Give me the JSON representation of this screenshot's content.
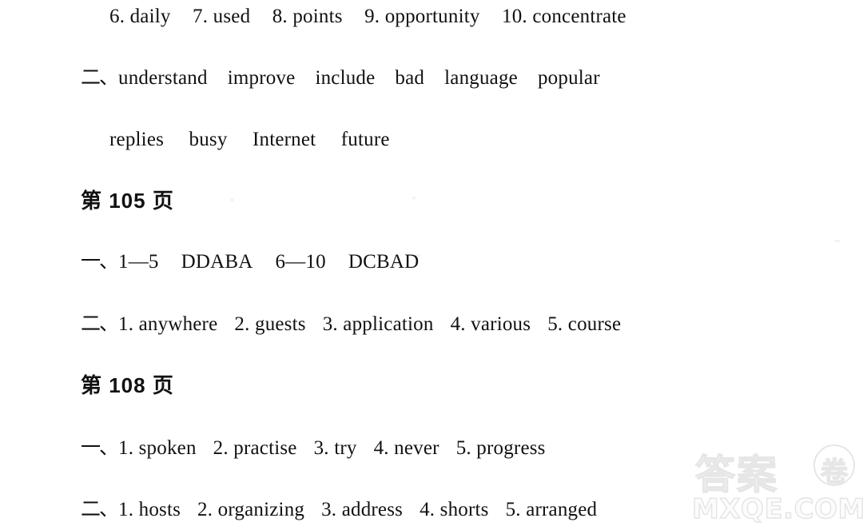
{
  "document": {
    "type": "answer-key-scan",
    "language": "zh-CN",
    "background_color": "#ffffff",
    "text_color": "#111111"
  },
  "lines": [
    {
      "id": "line_vocab_6_10",
      "kind": "answer-items",
      "marker": "",
      "items": [
        "6. daily",
        "7. used",
        "8. points",
        "9. opportunity",
        "10. concentrate"
      ]
    },
    {
      "id": "line_section_two_words_a",
      "kind": "word-list",
      "marker": "二、",
      "items": [
        "understand",
        "improve",
        "include",
        "bad",
        "language",
        "popular"
      ]
    },
    {
      "id": "line_section_two_words_b",
      "kind": "word-list-continued",
      "marker": "",
      "items": [
        "replies",
        "busy",
        "Internet",
        "future"
      ]
    },
    {
      "id": "heading_page_105",
      "kind": "page-heading",
      "text": "第 105 页"
    },
    {
      "id": "line_p105_section_one",
      "kind": "multiple-choice",
      "marker": "一、",
      "items": [
        "1—5",
        "DDABA",
        "6—10",
        "DCBAD"
      ]
    },
    {
      "id": "line_p105_section_two",
      "kind": "answer-items",
      "marker": "二、",
      "items": [
        "1. anywhere",
        "2. guests",
        "3. application",
        "4. various",
        "5. course"
      ]
    },
    {
      "id": "heading_page_108",
      "kind": "page-heading",
      "text": "第 108 页"
    },
    {
      "id": "line_p108_section_one",
      "kind": "answer-items",
      "marker": "一、",
      "items": [
        "1. spoken",
        "2. practise",
        "3. try",
        "4. never",
        "5. progress"
      ]
    },
    {
      "id": "line_p108_section_two",
      "kind": "answer-items",
      "marker": "二、",
      "items": [
        "1. hosts",
        "2. organizing",
        "3. address",
        "4. shorts",
        "5. arranged"
      ]
    }
  ],
  "watermark": {
    "chinese_text": "答案",
    "circled_char": "卷",
    "url": "MXQE.COM",
    "color": "#e6e6e6"
  }
}
